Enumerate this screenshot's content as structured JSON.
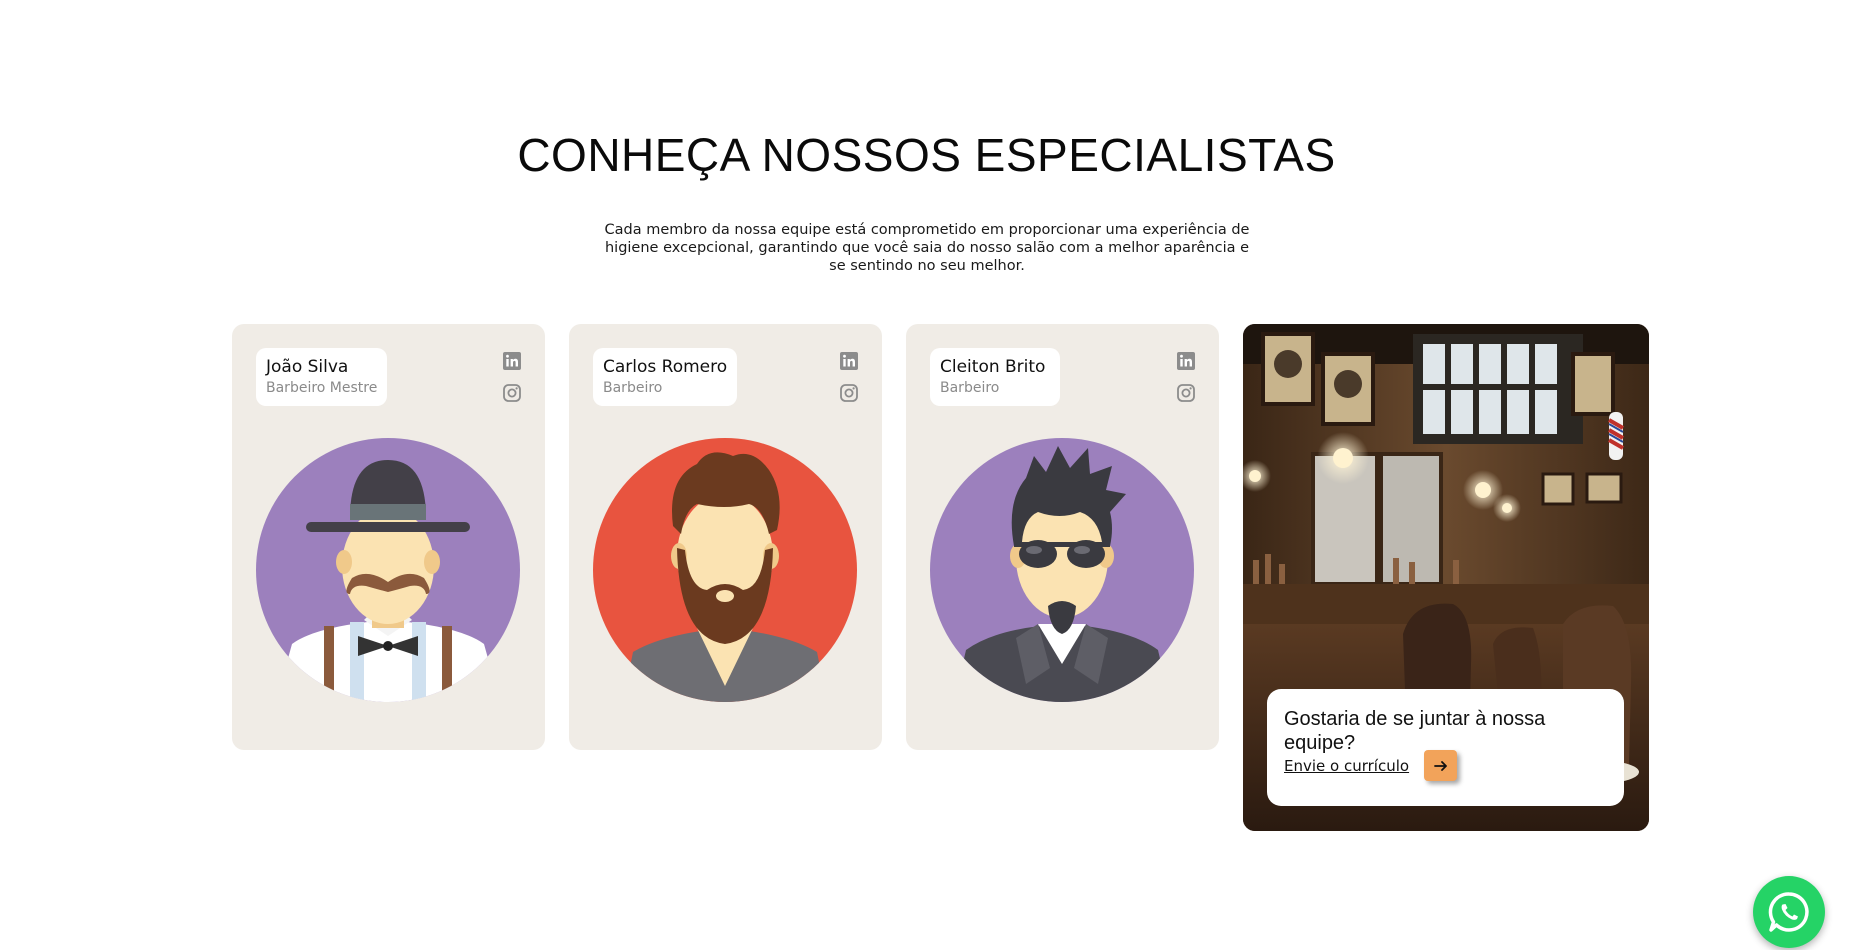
{
  "section": {
    "title": "CONHEÇA NOSSOS ESPECIALISTAS",
    "description": "Cada membro da nossa equipe está comprometido em proporcionar uma experiência de higiene excepcional, garantindo que você saia do nosso salão com a melhor aparência e se sentindo no seu melhor."
  },
  "team": [
    {
      "name": "João Silva",
      "role": "Barbeiro Mestre",
      "avatar_bg": "#9c80bd",
      "icons": [
        "linkedin-icon",
        "instagram-icon"
      ]
    },
    {
      "name": "Carlos Romero",
      "role": "Barbeiro",
      "avatar_bg": "#e8543f",
      "icons": [
        "linkedin-icon",
        "instagram-icon"
      ]
    },
    {
      "name": "Cleiton Brito",
      "role": "Barbeiro",
      "avatar_bg": "#9c80bd",
      "icons": [
        "linkedin-icon",
        "instagram-icon"
      ]
    }
  ],
  "join": {
    "question": "Gostaria de se juntar à nossa equipe?",
    "link_label": "Envie o currículo",
    "arrow_icon": "arrow-right-icon"
  },
  "floating": {
    "icon": "whatsapp-icon"
  },
  "colors": {
    "card_bg": "#f0ece6",
    "accent_orange": "#f2a35a",
    "whatsapp_green": "#25d366",
    "muted_text": "#8a8a8a"
  }
}
